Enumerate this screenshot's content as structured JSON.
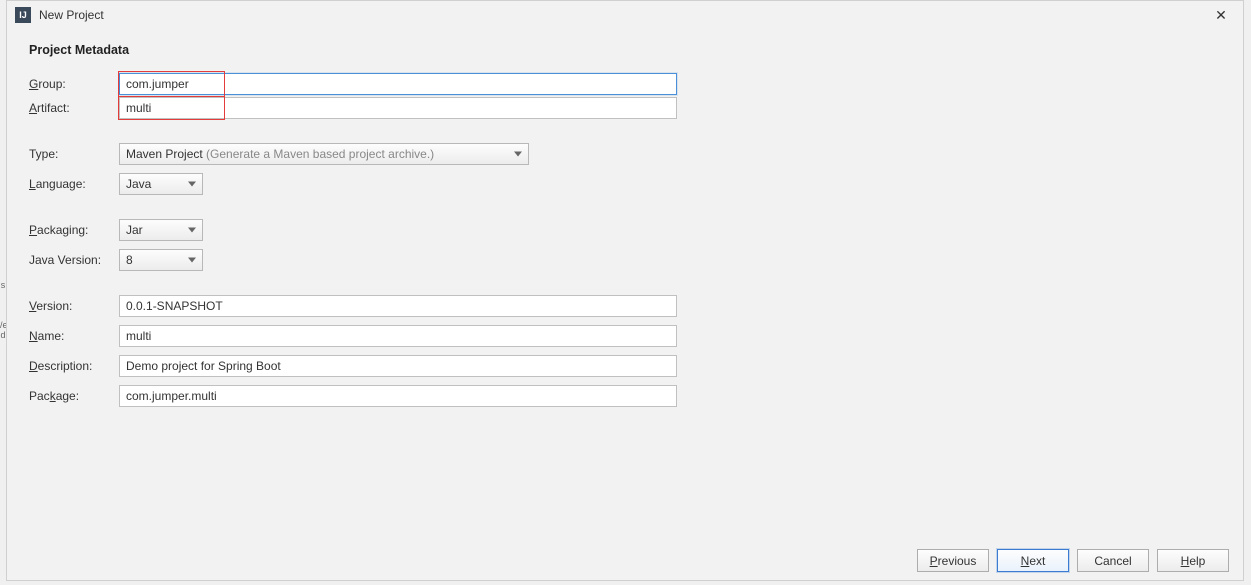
{
  "titlebar": {
    "title": "New Project",
    "app_icon_text": "IJ"
  },
  "section": {
    "heading": "Project Metadata"
  },
  "labels": {
    "group": "Group:",
    "artifact": "Artifact:",
    "type": "Type:",
    "language": "Language:",
    "packaging": "Packaging:",
    "java_version": "Java Version:",
    "version": "Version:",
    "name": "Name:",
    "description": "Description:",
    "package": "Package:"
  },
  "mnemonics": {
    "group": "G",
    "artifact": "A",
    "language": "L",
    "packaging": "P",
    "version": "V",
    "name": "N",
    "description": "D",
    "package": "k",
    "previous": "P",
    "next": "N",
    "help": "H"
  },
  "fields": {
    "group": "com.jumper",
    "artifact": "multi",
    "type_value": "Maven Project",
    "type_hint": "(Generate a Maven based project archive.)",
    "language": "Java",
    "packaging": "Jar",
    "java_version": "8",
    "version": "0.0.1-SNAPSHOT",
    "name": "multi",
    "description": "Demo project for Spring Boot",
    "package": "com.jumper.multi"
  },
  "buttons": {
    "previous": "Previous",
    "next": "Next",
    "cancel": "Cancel",
    "help": "Help"
  }
}
